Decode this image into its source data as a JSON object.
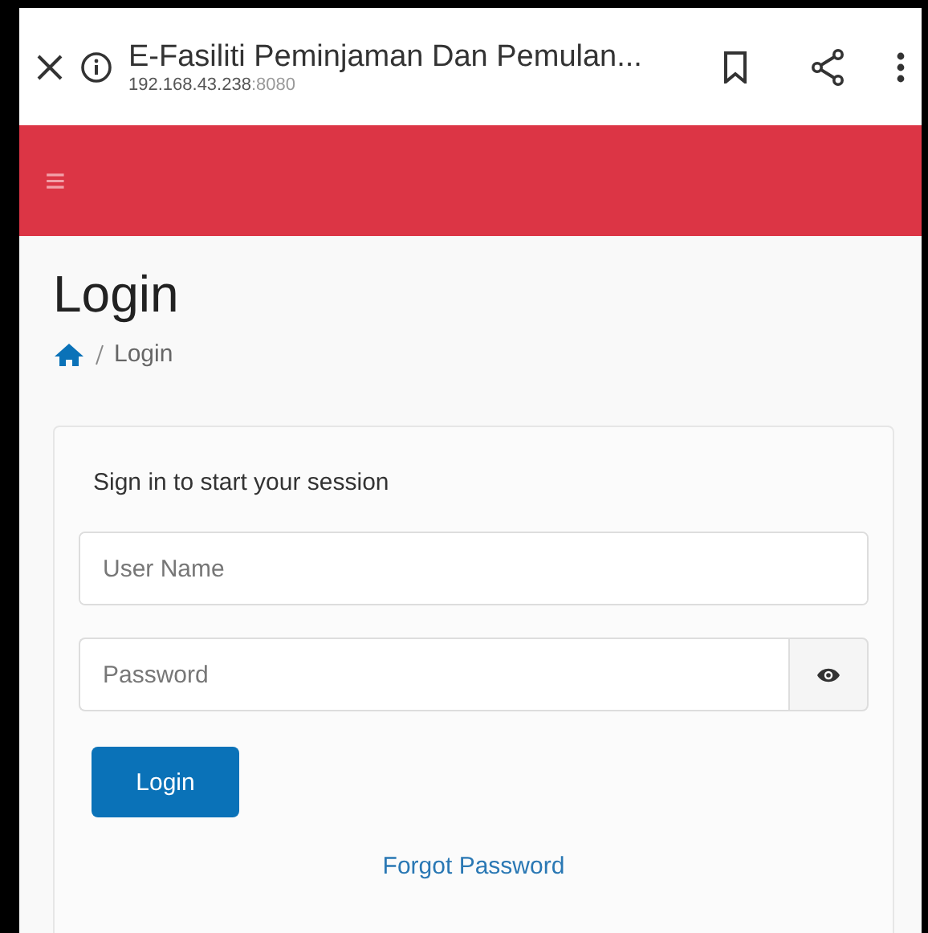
{
  "browser": {
    "title": "E-Fasiliti Peminjaman Dan Pemulan...",
    "url_host": "192.168.43.238",
    "url_port": ":8080"
  },
  "header": {
    "menu_icon": "≡"
  },
  "page": {
    "title": "Login",
    "breadcrumb": [
      "Login"
    ]
  },
  "login_card": {
    "prompt": "Sign in to start your session",
    "fields": [
      {
        "kind": "text",
        "placeholder": "User Name"
      },
      {
        "kind": "password",
        "placeholder": "Password"
      }
    ],
    "submit": "Login",
    "forgot_link": "Forgot Password"
  }
}
